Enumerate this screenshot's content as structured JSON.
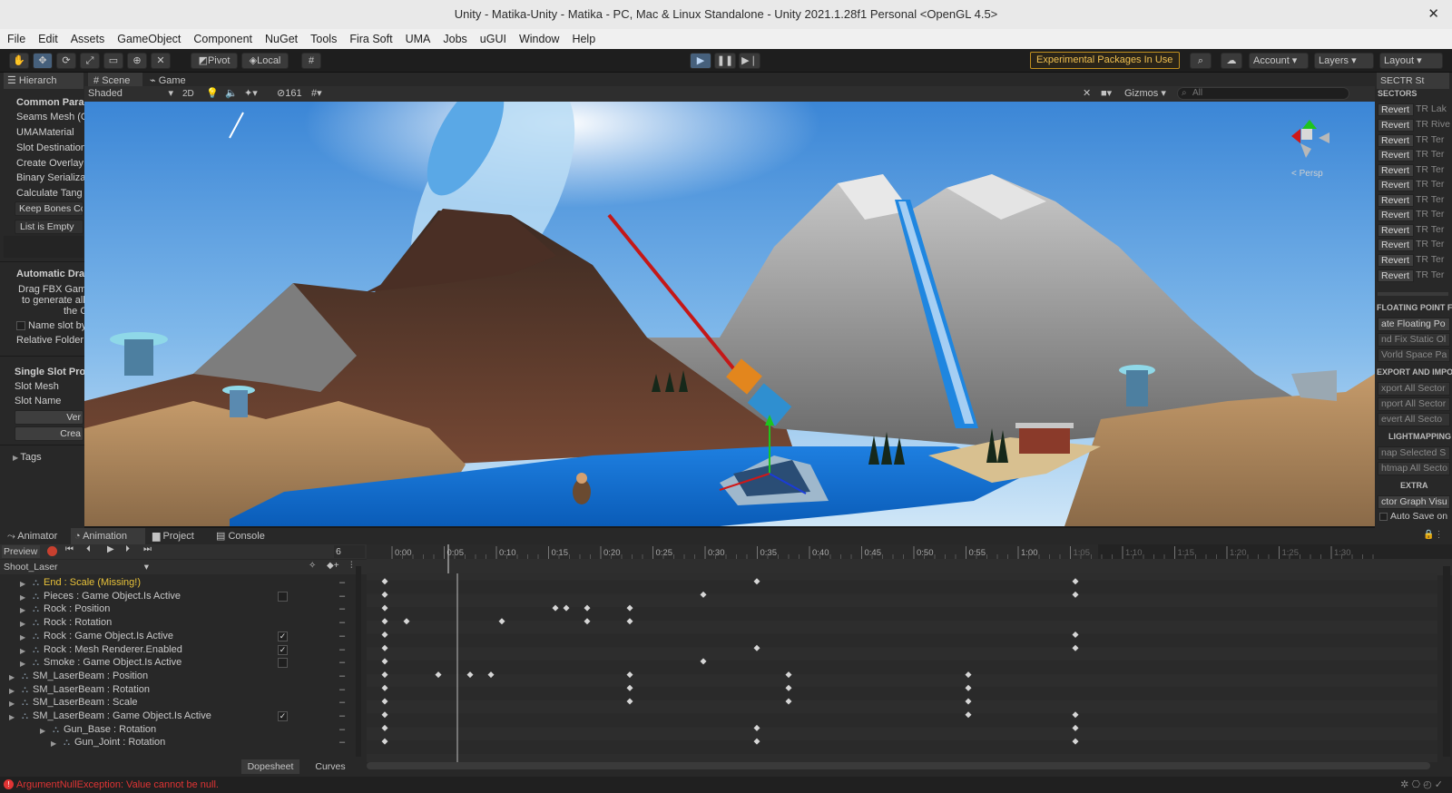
{
  "window": {
    "title": "Unity - Matika-Unity - Matika - PC, Mac & Linux Standalone - Unity 2021.1.28f1 Personal <OpenGL 4.5>",
    "close": "✕"
  },
  "menu": [
    "File",
    "Edit",
    "Assets",
    "GameObject",
    "Component",
    "NuGet",
    "Tools",
    "Fira Soft",
    "UMA",
    "Jobs",
    "uGUI",
    "Window",
    "Help"
  ],
  "toolbar": {
    "pivot": "Pivot",
    "local": "Local",
    "experimental": "Experimental Packages In Use ▾",
    "account": "Account",
    "layers": "Layers",
    "layout": "Layout"
  },
  "hierarchy": {
    "tab": "Hierarch",
    "common_header": "Common Paran",
    "items": [
      "Seams Mesh (O",
      "UMAMaterial",
      "Slot Destination",
      "Create Overlay",
      "Binary Serializa",
      "Calculate Tang"
    ],
    "keep_bones": "Keep Bones Co",
    "list_empty": "List is Empty",
    "auto_header": "Automatic Drag",
    "drag_lines": [
      "Drag FBX Game",
      "to generate all",
      "the C"
    ],
    "name_slot": "Name slot by",
    "relative_folder": "Relative Folder",
    "single_header": "Single Slot Proc",
    "slot_mesh": "Slot Mesh",
    "slot_name": "Slot Name",
    "ver_button": "Ver",
    "cre_button": "Crea",
    "tags": "Tags"
  },
  "scene": {
    "tab_scene": "Scene",
    "tab_game": "Game",
    "shading": "Shaded",
    "mode2d": "2D",
    "hidden_count": "161",
    "gizmos": "Gizmos",
    "search_placeholder": "All",
    "persp": "< Persp"
  },
  "sectr": {
    "tab": "SECTR St",
    "sectors_header": "SECTORS",
    "revert_label": "Revert",
    "rows": [
      "TR Lak",
      "TR Rive",
      "TR Ter",
      "TR Ter",
      "TR Ter",
      "TR Ter",
      "TR Ter",
      "TR Ter",
      "TR Ter",
      "TR Ter",
      "TR Ter",
      "TR Ter"
    ],
    "floating_header": "FLOATING POINT FIX",
    "floating_items": [
      "ate Floating Po",
      "nd Fix Static Ol",
      "Vorld Space Pa"
    ],
    "export_header": "EXPORT AND IMPORT",
    "export_items": [
      "xport All Sector",
      "nport All Sector",
      "evert All Secto"
    ],
    "lightmap_header": "LIGHTMAPPING",
    "lightmap_items": [
      "nap Selected S",
      "htmap All Secto"
    ],
    "extra_header": "EXTRA",
    "extra_items": [
      "ctor Graph Visu"
    ],
    "auto_save": "Auto Save on"
  },
  "animation": {
    "tabs": [
      "Animator",
      "Animation",
      "Project",
      "Console"
    ],
    "preview": "Preview",
    "frame": "6",
    "clip": "Shoot_Laser",
    "ticks": [
      "0:00",
      "0:05",
      "0:10",
      "0:15",
      "0:20",
      "0:25",
      "0:30",
      "0:35",
      "0:40",
      "0:45",
      "0:50",
      "0:55",
      "1:00",
      "1:05",
      "1:10",
      "1:15",
      "1:20",
      "1:25",
      "1:30"
    ],
    "properties": [
      {
        "label": "End : Scale (Missing!)",
        "missing": true,
        "indent": 1,
        "checkbox": ""
      },
      {
        "label": "Pieces : Game Object.Is Active",
        "indent": 1,
        "checkbox": " "
      },
      {
        "label": "Rock : Position",
        "indent": 1,
        "checkbox": ""
      },
      {
        "label": "Rock : Rotation",
        "indent": 1,
        "checkbox": ""
      },
      {
        "label": "Rock : Game Object.Is Active",
        "indent": 1,
        "checkbox": "✓"
      },
      {
        "label": "Rock : Mesh Renderer.Enabled",
        "indent": 1,
        "checkbox": "✓"
      },
      {
        "label": "Smoke : Game Object.Is Active",
        "indent": 1,
        "checkbox": " "
      },
      {
        "label": "SM_LaserBeam : Position",
        "indent": 0,
        "checkbox": ""
      },
      {
        "label": "SM_LaserBeam : Rotation",
        "indent": 0,
        "checkbox": ""
      },
      {
        "label": "SM_LaserBeam : Scale",
        "indent": 0,
        "checkbox": ""
      },
      {
        "label": "SM_LaserBeam : Game Object.Is Active",
        "indent": 0,
        "checkbox": "✓"
      },
      {
        "label": "Gun_Base : Rotation",
        "indent": 2,
        "checkbox": ""
      },
      {
        "label": "Gun_Joint : Rotation",
        "indent": 3,
        "checkbox": ""
      }
    ],
    "dopesheet": "Dopesheet",
    "curves": "Curves"
  },
  "status": {
    "error": "ArgumentNullException: Value cannot be null."
  },
  "colors": {
    "accent": "#46607c",
    "warning": "#f0c050",
    "error": "#e03434",
    "missing": "#e8c23a"
  }
}
